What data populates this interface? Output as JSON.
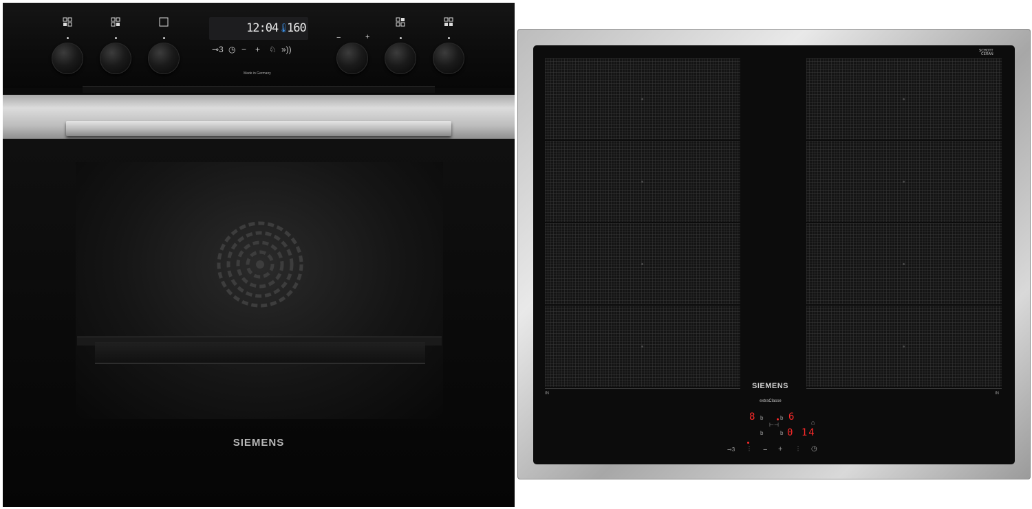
{
  "oven": {
    "display": {
      "time": "12:04",
      "temperature": "160"
    },
    "touch_controls": [
      "⊸3",
      "◷",
      "−",
      "+",
      "♘",
      "»))"
    ],
    "made_in": "Made in Germany",
    "brand": "SIEMENS",
    "icons": [
      "mode-grid-icon",
      "mode-square-icon",
      "wifi-icon",
      "clock-icon",
      "child-lock-icon"
    ]
  },
  "hob": {
    "brand": "SIEMENS",
    "sublabel": "extraClasse",
    "glass_brand": "SCHOTT\nCERAN",
    "in_label_left": "IN",
    "in_label_right": "IN",
    "readouts": {
      "zone_left_power": "8",
      "zone_right_power": "6",
      "timer": "0 14",
      "b_labels": [
        "b",
        "b",
        "b",
        "b"
      ]
    },
    "controls": [
      "⊸3",
      "−",
      "+",
      "◷"
    ],
    "colors": {
      "display_red": "#ff2a2a",
      "stainless": "#cfcfcf"
    }
  }
}
